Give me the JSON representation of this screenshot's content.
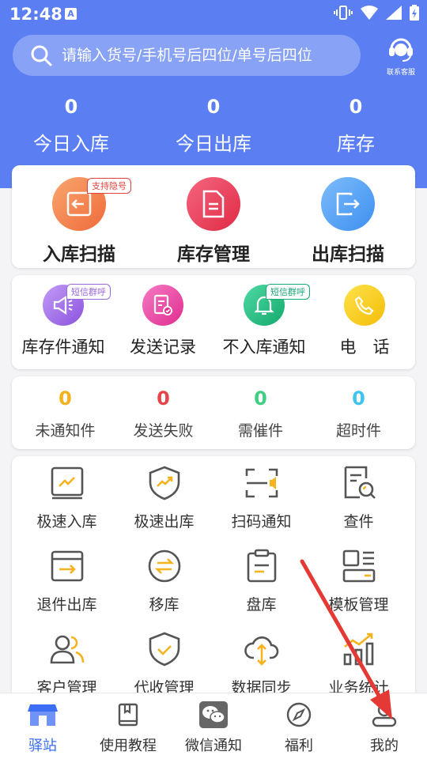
{
  "status_bar": {
    "time": "12:48"
  },
  "search": {
    "placeholder": "请输入货号/手机号后四位/单号后四位"
  },
  "customer_service": {
    "label": "联系客服"
  },
  "stats": [
    {
      "value": "0",
      "label": "今日入库"
    },
    {
      "value": "0",
      "label": "今日出库"
    },
    {
      "value": "0",
      "label": "库存"
    }
  ],
  "main_actions": [
    {
      "label": "入库扫描",
      "badge": "支持隐号",
      "icon": "import-icon",
      "color": "#f47c4c"
    },
    {
      "label": "库存管理",
      "badge": "",
      "icon": "document-icon",
      "color": "#ec3c58"
    },
    {
      "label": "出库扫描",
      "badge": "",
      "icon": "export-icon",
      "color": "#4fa2f4"
    }
  ],
  "notify_actions": [
    {
      "label": "库存件通知",
      "badge": "短信群呼",
      "icon": "megaphone-icon",
      "color": "#a46be6"
    },
    {
      "label": "发送记录",
      "badge": "",
      "icon": "record-icon",
      "color": "#e83fa0"
    },
    {
      "label": "不入库通知",
      "badge": "短信群呼",
      "icon": "bell-icon",
      "color": "#1fba7e"
    },
    {
      "label": "电　话",
      "badge": "",
      "icon": "phone-icon",
      "color": "#f7c81a"
    }
  ],
  "counters": [
    {
      "value": "0",
      "label": "未通知件",
      "color": "#f3b21c"
    },
    {
      "value": "0",
      "label": "发送失败",
      "color": "#e7434a"
    },
    {
      "value": "0",
      "label": "需催件",
      "color": "#3ecf83"
    },
    {
      "value": "0",
      "label": "超时件",
      "color": "#3fc3ef"
    }
  ],
  "tools": [
    {
      "label": "极速入库",
      "icon": "fast-in-icon"
    },
    {
      "label": "极速出库",
      "icon": "fast-out-icon"
    },
    {
      "label": "扫码通知",
      "icon": "scan-notify-icon"
    },
    {
      "label": "查件",
      "icon": "search-doc-icon"
    },
    {
      "label": "退件出库",
      "icon": "return-icon"
    },
    {
      "label": "移库",
      "icon": "transfer-icon"
    },
    {
      "label": "盘库",
      "icon": "clipboard-icon"
    },
    {
      "label": "模板管理",
      "icon": "template-icon"
    },
    {
      "label": "客户管理",
      "icon": "customers-icon"
    },
    {
      "label": "代收管理",
      "icon": "shield-check-icon"
    },
    {
      "label": "数据同步",
      "icon": "cloud-sync-icon"
    },
    {
      "label": "业务统计",
      "icon": "stats-icon"
    }
  ],
  "bottom_nav": [
    {
      "label": "驿站",
      "icon": "store-icon",
      "active": true
    },
    {
      "label": "使用教程",
      "icon": "book-icon",
      "active": false
    },
    {
      "label": "微信通知",
      "icon": "wechat-icon",
      "active": false
    },
    {
      "label": "福利",
      "icon": "compass-icon",
      "active": false
    },
    {
      "label": "我的",
      "icon": "profile-icon",
      "active": false
    }
  ],
  "colors": {
    "primary": "#5b7ff3",
    "accent": "#3b6ef5",
    "annotation_arrow": "#e53935",
    "tool_accent": "#f5b31f"
  }
}
